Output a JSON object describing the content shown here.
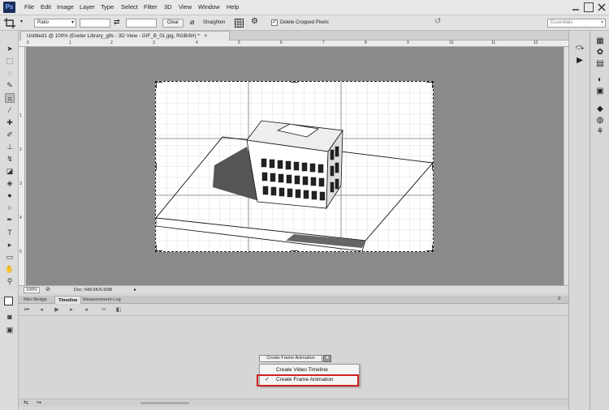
{
  "app": {
    "logo": "Ps"
  },
  "menu": [
    "File",
    "Edit",
    "Image",
    "Layer",
    "Type",
    "Select",
    "Filter",
    "3D",
    "View",
    "Window",
    "Help"
  ],
  "options": {
    "ratio_label": "Ratio",
    "clear_label": "Clear",
    "straighten_label": "Straighten",
    "delete_cropped_label": "Delete Cropped Pixels",
    "workspace_label": "Essentials"
  },
  "document": {
    "tab_title": "Untitled1 @ 100% (Exeter Library_gifs - 3D View - GIF_B_01.jpg, RGB/8#) *",
    "close_label": "×"
  },
  "ruler": {
    "top": [
      "0",
      "1",
      "2",
      "3",
      "4",
      "5",
      "6",
      "7",
      "8",
      "9",
      "10",
      "11",
      "12"
    ],
    "left": [
      "1",
      "2",
      "3",
      "4",
      "5"
    ]
  },
  "status": {
    "zoom": "100%",
    "doc_info": "Doc: 648.6K/5.60M"
  },
  "panel": {
    "tabs": [
      "Mini Bridge",
      "Timeline",
      "Measurement Log"
    ],
    "create_button": "Create Frame Animation",
    "menu_items": [
      "Create Video Timeline",
      "Create Frame Animation"
    ],
    "selected_mark": "✓"
  },
  "colors": {
    "canvas": "#8a8a8a",
    "highlight": "#d12222",
    "accent": "#1b2d5a"
  }
}
